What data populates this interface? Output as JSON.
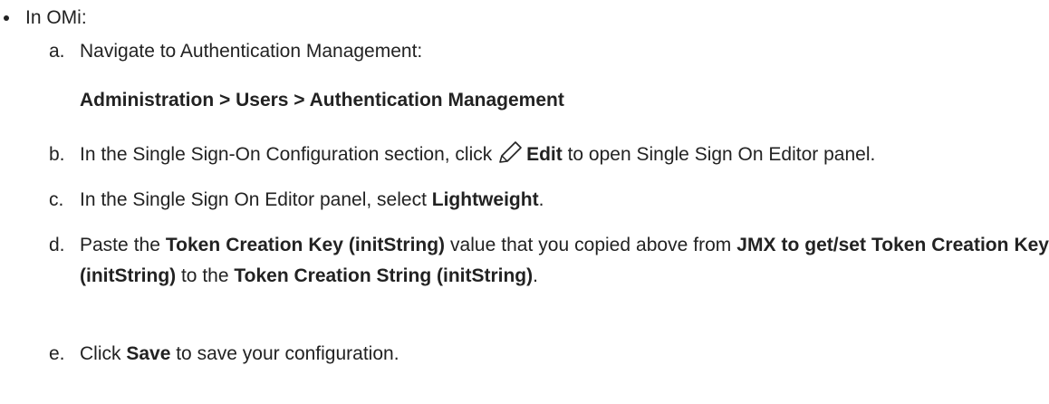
{
  "intro": {
    "label": "In OMi:"
  },
  "steps": {
    "a": {
      "marker": "a.",
      "text": "Navigate to Authentication Management:",
      "path": "Administration > Users > Authentication Management"
    },
    "b": {
      "marker": "b.",
      "part1": "In the Single Sign-On Configuration section, click ",
      "icon": "pencil-edit-icon",
      "bold": "Edit",
      "part2": " to open Single Sign On Editor panel."
    },
    "c": {
      "marker": "c.",
      "part1": "In the Single Sign On Editor panel, select ",
      "bold": "Lightweight",
      "part2": "."
    },
    "d": {
      "marker": "d.",
      "part1": "Paste the ",
      "bold1": "Token Creation Key (initString)",
      "part2": " value that you copied above from ",
      "bold2": "JMX to get/set Token Creation Key (initString)",
      "part3": " to the ",
      "bold3": "Token Creation String (initString)",
      "part4": "."
    },
    "e": {
      "marker": "e.",
      "part1": "Click ",
      "bold": "Save",
      "part2": " to save your configuration."
    }
  }
}
